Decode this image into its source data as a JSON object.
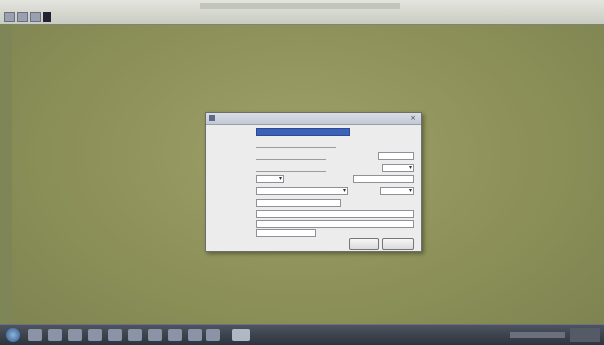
{
  "desktop": {
    "menu": [
      "",
      ""
    ]
  },
  "dialog": {
    "title": "",
    "fields": [
      {
        "label": "",
        "value": ""
      },
      {
        "label": "",
        "value": ""
      },
      {
        "label": "",
        "value": "",
        "side_label": "",
        "side_value": ""
      },
      {
        "label": "",
        "value": "",
        "side_label": "",
        "side_value": ""
      },
      {
        "label": "",
        "value": "",
        "side_label": "",
        "side_value": ""
      },
      {
        "label": "",
        "value": "",
        "side_label": "",
        "side_value": ""
      },
      {
        "label": "",
        "value": "",
        "side_label": ""
      },
      {
        "label": "",
        "value": ""
      },
      {
        "label": "",
        "value": ""
      },
      {
        "label": "",
        "value": ""
      }
    ],
    "ok_label": "",
    "cancel_label": ""
  },
  "taskbar": {
    "clock": ""
  },
  "colors": {
    "desktop": "#8f9360",
    "selection": "#3c62b8",
    "taskbar": "#3a414b"
  }
}
